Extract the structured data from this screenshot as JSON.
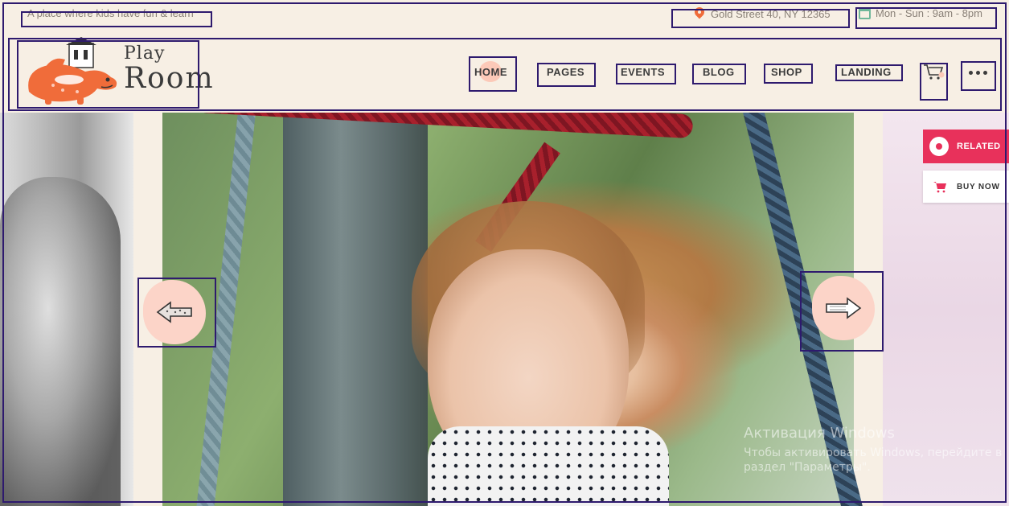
{
  "topbar": {
    "tagline": "A place where kids have fun & learn",
    "address": "Gold Street 40, NY 12365",
    "hours": "Mon - Sun : 9am - 8pm",
    "address_icon": "map-pin-icon",
    "hours_icon": "calendar-icon"
  },
  "logo": {
    "line1": "Play",
    "line2": "Room",
    "colors": {
      "dino": "#f06c3a",
      "accent": "#fcc9b8"
    }
  },
  "nav": {
    "items": [
      {
        "label": "HOME",
        "active": true
      },
      {
        "label": "PAGES",
        "active": false
      },
      {
        "label": "EVENTS",
        "active": false
      },
      {
        "label": "BLOG",
        "active": false
      },
      {
        "label": "SHOP",
        "active": false
      },
      {
        "label": "LANDING",
        "active": false
      }
    ],
    "cart_icon": "cart-icon",
    "more_icon": "more-dots-icon"
  },
  "slider": {
    "prev_icon": "arrow-left-icon",
    "next_icon": "arrow-right-icon",
    "accent": "#fcd4c8"
  },
  "side_panel": {
    "related_label": "RELATED",
    "buy_label": "BUY NOW",
    "related_color": "#e8315b"
  },
  "watermark": {
    "title": "Активация Windows",
    "line1": "Чтобы активировать Windows, перейдите в",
    "line2": "раздел \"Параметры\"."
  }
}
